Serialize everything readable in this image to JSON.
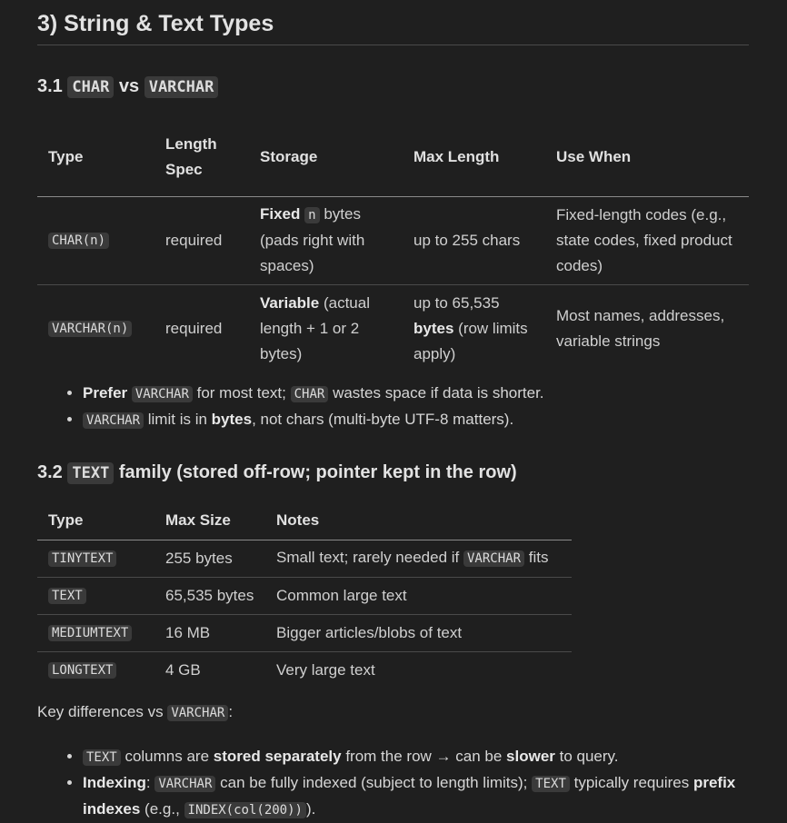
{
  "heading": "3) String & Text Types",
  "s1": {
    "prefix": "3.1",
    "code_char": "CHAR",
    "vs": "vs",
    "code_varchar": "VARCHAR"
  },
  "table1": {
    "headers": [
      "Type",
      "Length Spec",
      "Storage",
      "Max Length",
      "Use When"
    ],
    "row1": {
      "type": "CHAR(n)",
      "spec": "required",
      "storage_bold": "Fixed",
      "storage_code": "n",
      "storage_rest": "bytes (pads right with spaces)",
      "max": "up to 255 chars",
      "use": "Fixed-length codes (e.g., state codes, fixed product codes)"
    },
    "row2": {
      "type": "VARCHAR(n)",
      "spec": "required",
      "storage_bold": "Variable",
      "storage_rest": "(actual length + 1 or 2 bytes)",
      "max_pre": "up to 65,535",
      "max_bold": "bytes",
      "max_post": "(row limits apply)",
      "use": "Most names, addresses, variable strings"
    }
  },
  "bullets1": {
    "b1_bold": "Prefer",
    "b1_code1": "VARCHAR",
    "b1_mid": "for most text;",
    "b1_code2": "CHAR",
    "b1_end": "wastes space if data is shorter.",
    "b2_code": "VARCHAR",
    "b2_mid": "limit is in",
    "b2_bold": "bytes",
    "b2_end": ", not chars (multi-byte UTF-8 matters)."
  },
  "s2": {
    "prefix": "3.2",
    "code": "TEXT",
    "rest": "family (stored off-row; pointer kept in the row)"
  },
  "table2": {
    "headers": [
      "Type",
      "Max Size",
      "Notes"
    ],
    "rows": [
      {
        "type": "TINYTEXT",
        "size": "255 bytes",
        "notes": "Small text; rarely needed if",
        "notes_code": "VARCHAR",
        "notes_end": "fits"
      },
      {
        "type": "TEXT",
        "size": "65,535 bytes",
        "notes": "Common large text"
      },
      {
        "type": "MEDIUMTEXT",
        "size": "16 MB",
        "notes": "Bigger articles/blobs of text"
      },
      {
        "type": "LONGTEXT",
        "size": "4 GB",
        "notes": "Very large text"
      }
    ]
  },
  "keydiff": {
    "label": "Key differences vs",
    "code": "VARCHAR",
    "colon": ":"
  },
  "bullets2": {
    "b1_code": "TEXT",
    "b1_mid": "columns are",
    "b1_bold1": "stored separately",
    "b1_mid2": "from the row → can be",
    "b1_bold2": "slower",
    "b1_end": "to query.",
    "b2_bold1": "Indexing",
    "b2_colon": ":",
    "b2_code1": "VARCHAR",
    "b2_mid": "can be fully indexed (subject to length limits);",
    "b2_code2": "TEXT",
    "b2_mid2": "typically requires",
    "b2_bold2": "prefix indexes",
    "b2_mid3": "(e.g.,",
    "b2_code3": "INDEX(col(200))",
    "b2_end": ")."
  }
}
